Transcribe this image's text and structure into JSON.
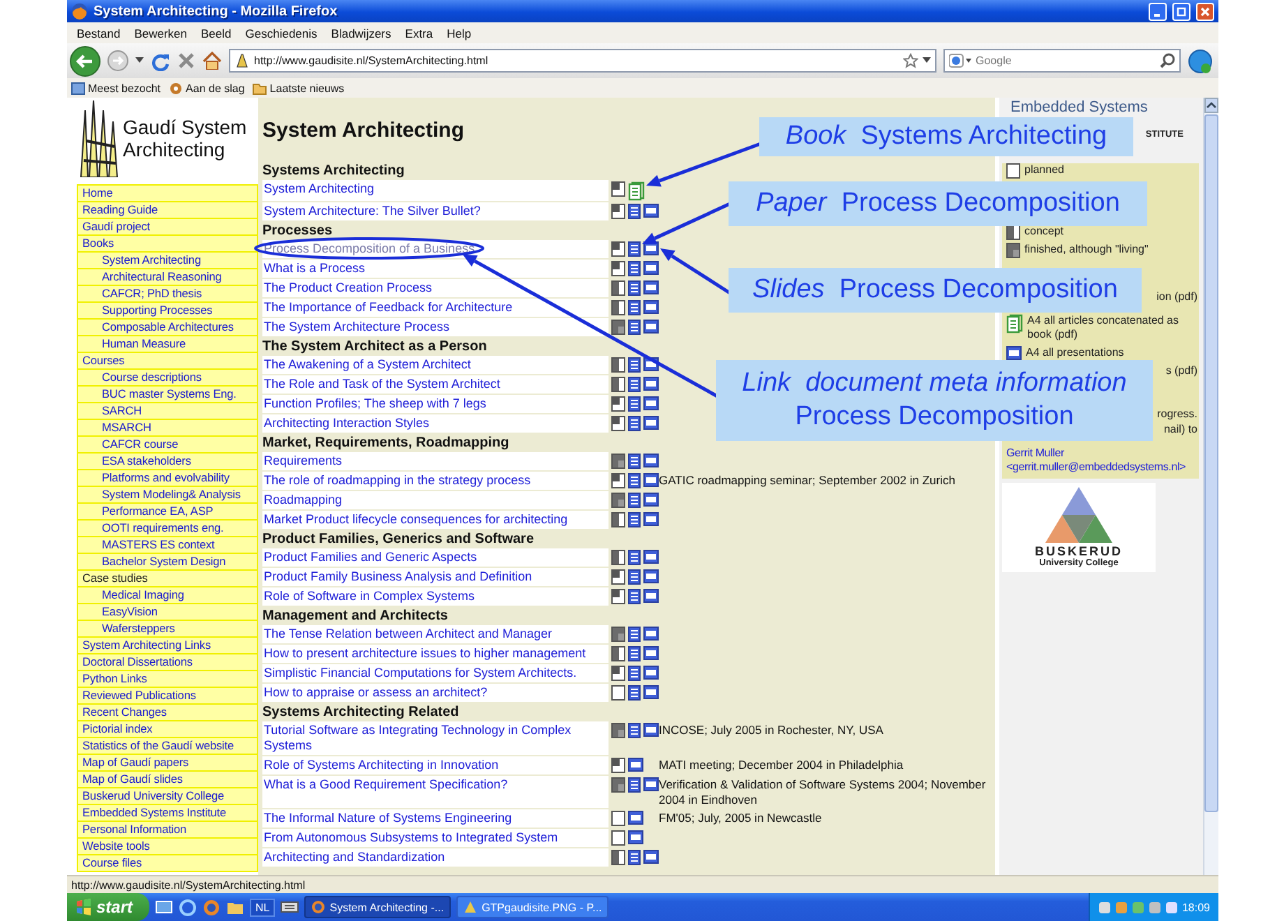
{
  "window": {
    "title": "System Architecting - Mozilla Firefox"
  },
  "menu": [
    "Bestand",
    "Bewerken",
    "Beeld",
    "Geschiedenis",
    "Bladwijzers",
    "Extra",
    "Help"
  ],
  "address_bar": {
    "value": "http://www.gaudisite.nl/SystemArchitecting.html"
  },
  "search": {
    "placeholder": "Google"
  },
  "bookmarks": [
    "Meest bezocht",
    "Aan de slag",
    "Laatste nieuws"
  ],
  "site_logo": "Gaudí System Architecting",
  "nav": [
    {
      "label": "Home",
      "linked": true
    },
    {
      "label": "Reading Guide",
      "linked": true
    },
    {
      "label": "Gaudí project",
      "linked": true
    },
    {
      "label": "Books",
      "linked": true,
      "children": [
        {
          "label": "System Architecting"
        },
        {
          "label": "Architectural Reasoning"
        },
        {
          "label": "CAFCR; PhD thesis"
        },
        {
          "label": "Supporting Processes"
        },
        {
          "label": "Composable Architectures"
        },
        {
          "label": "Human Measure"
        }
      ]
    },
    {
      "label": "Courses",
      "linked": true,
      "children": [
        {
          "label": "Course descriptions"
        },
        {
          "label": "BUC master Systems Eng."
        },
        {
          "label": "SARCH"
        },
        {
          "label": "MSARCH"
        },
        {
          "label": "CAFCR course"
        },
        {
          "label": "ESA stakeholders"
        },
        {
          "label": "Platforms and evolvability"
        },
        {
          "label": "System Modeling& Analysis"
        },
        {
          "label": "Performance EA, ASP"
        },
        {
          "label": "OOTI requirements eng."
        },
        {
          "label": "MASTERS ES context"
        },
        {
          "label": "Bachelor System Design"
        }
      ]
    },
    {
      "label": "Case studies",
      "linked": false,
      "children": [
        {
          "label": "Medical Imaging"
        },
        {
          "label": "EasyVision"
        },
        {
          "label": "Wafersteppers"
        }
      ]
    },
    {
      "label": "System Architecting Links",
      "linked": true
    },
    {
      "label": "Doctoral Dissertations",
      "linked": true
    },
    {
      "label": "Python Links",
      "linked": true
    },
    {
      "label": "Reviewed Publications",
      "linked": true
    },
    {
      "label": "Recent Changes",
      "linked": true
    },
    {
      "label": "Pictorial index",
      "linked": true
    },
    {
      "label": "Statistics of the Gaudí website",
      "linked": true
    },
    {
      "label": "Map of Gaudí papers",
      "linked": true
    },
    {
      "label": "Map of Gaudí slides",
      "linked": true
    },
    {
      "label": "Buskerud University College",
      "linked": true
    },
    {
      "label": "Embedded Systems Institute",
      "linked": true
    },
    {
      "label": "Personal Information",
      "linked": true
    },
    {
      "label": "Website tools",
      "linked": true
    },
    {
      "label": "Course files",
      "linked": true
    }
  ],
  "page_title": "System Architecting",
  "sections": [
    {
      "heading": "Systems Architecting",
      "rows": [
        {
          "title": "System Architecting",
          "visited": false,
          "kind": "draft",
          "book": true,
          "paper": false,
          "slides": false
        },
        {
          "title": "System Architecture: The Silver Bullet?",
          "visited": false,
          "kind": "draft",
          "book": false,
          "paper": true,
          "slides": true
        }
      ]
    },
    {
      "heading": "Processes",
      "rows": [
        {
          "title": "Process Decomposition of a Business",
          "visited": true,
          "kind": "draft",
          "book": false,
          "paper": true,
          "slides": true
        },
        {
          "title": "What is a Process",
          "visited": false,
          "kind": "draft",
          "book": false,
          "paper": true,
          "slides": true
        },
        {
          "title": "The Product Creation Process",
          "visited": false,
          "kind": "concept",
          "book": false,
          "paper": true,
          "slides": true
        },
        {
          "title": "The Importance of Feedback for Architecture",
          "visited": false,
          "kind": "concept",
          "book": false,
          "paper": true,
          "slides": true
        },
        {
          "title": "The System Architecture Process",
          "visited": false,
          "kind": "finished",
          "book": false,
          "paper": true,
          "slides": true
        }
      ]
    },
    {
      "heading": "The System Architect as a Person",
      "rows": [
        {
          "title": "The Awakening of a System Architect",
          "visited": false,
          "kind": "concept",
          "book": false,
          "paper": true,
          "slides": true
        },
        {
          "title": "The Role and Task of the System Architect",
          "visited": false,
          "kind": "concept",
          "book": false,
          "paper": true,
          "slides": true
        },
        {
          "title": "Function Profiles; The sheep with 7 legs",
          "visited": false,
          "kind": "draft",
          "book": false,
          "paper": true,
          "slides": true
        },
        {
          "title": "Architecting Interaction Styles",
          "visited": false,
          "kind": "draft",
          "book": false,
          "paper": true,
          "slides": true
        }
      ]
    },
    {
      "heading": "Market, Requirements, Roadmapping",
      "rows": [
        {
          "title": "Requirements",
          "visited": false,
          "kind": "finished",
          "book": false,
          "paper": true,
          "slides": true
        },
        {
          "title": "The role of roadmapping in the strategy process",
          "visited": false,
          "kind": "draft",
          "book": false,
          "paper": true,
          "slides": true,
          "note": "GATIC roadmapping seminar; September 2002 in Zurich"
        },
        {
          "title": "Roadmapping",
          "visited": false,
          "kind": "finished",
          "book": false,
          "paper": true,
          "slides": true
        },
        {
          "title": "Market Product lifecycle consequences for architecting",
          "visited": false,
          "kind": "concept",
          "book": false,
          "paper": true,
          "slides": true
        }
      ]
    },
    {
      "heading": "Product Families, Generics and Software",
      "rows": [
        {
          "title": "Product Families and Generic Aspects",
          "visited": false,
          "kind": "concept",
          "book": false,
          "paper": true,
          "slides": true
        },
        {
          "title": "Product Family Business Analysis and Definition",
          "visited": false,
          "kind": "draft",
          "book": false,
          "paper": true,
          "slides": true
        },
        {
          "title": "Role of Software in Complex Systems",
          "visited": false,
          "kind": "draft",
          "book": false,
          "paper": true,
          "slides": true
        }
      ]
    },
    {
      "heading": "Management and Architects",
      "rows": [
        {
          "title": "The Tense Relation between Architect and Manager",
          "visited": false,
          "kind": "finished",
          "book": false,
          "paper": true,
          "slides": true
        },
        {
          "title": "How to present architecture issues to higher management",
          "visited": false,
          "kind": "concept",
          "book": false,
          "paper": true,
          "slides": true
        },
        {
          "title": "Simplistic Financial Computations for System Architects.",
          "visited": false,
          "kind": "draft",
          "book": false,
          "paper": true,
          "slides": true
        },
        {
          "title": "How to appraise or assess an architect?",
          "visited": false,
          "kind": "planned",
          "book": false,
          "paper": true,
          "slides": true
        }
      ]
    },
    {
      "heading": "Systems Architecting Related",
      "rows": [
        {
          "title": "Tutorial Software as Integrating Technology in Complex Systems",
          "visited": false,
          "kind": "finished",
          "book": false,
          "paper": true,
          "slides": true,
          "note": "INCOSE; July 2005 in Rochester, NY, USA"
        },
        {
          "title": "Role of Systems Architecting in Innovation",
          "visited": false,
          "kind": "draft",
          "book": false,
          "paper": false,
          "slides": true,
          "note": "MATI meeting; December 2004 in Philadelphia"
        },
        {
          "title": "What is a Good Requirement Specification?",
          "visited": false,
          "kind": "finished",
          "book": false,
          "paper": true,
          "slides": true,
          "note": "Verification & Validation of Software Systems 2004; November 2004 in Eindhoven"
        },
        {
          "title": "The Informal Nature of Systems Engineering",
          "visited": false,
          "kind": "planned",
          "book": false,
          "paper": false,
          "slides": true,
          "note": "FM'05; July, 2005 in Newcastle"
        },
        {
          "title": "From Autonomous Subsystems to Integrated System",
          "visited": false,
          "kind": "planned",
          "book": false,
          "paper": false,
          "slides": true
        },
        {
          "title": "Architecting and Standardization",
          "visited": false,
          "kind": "concept",
          "book": false,
          "paper": true,
          "slides": true
        }
      ]
    }
  ],
  "side_panel": {
    "logo": "Embedded Systems",
    "logo_fragment": "STITUTE",
    "lines": [
      {
        "kind": "planned",
        "text": "planned"
      },
      {
        "kind": "concept",
        "text": "concept"
      },
      {
        "kind": "finished",
        "text": "finished, although \"living\""
      },
      {
        "kind": "fragment",
        "text": "ion (pdf)"
      },
      {
        "kind": "book",
        "text": "A4 all articles concatenated as book (pdf)"
      },
      {
        "kind": "slides",
        "text": "A4 all presentations"
      },
      {
        "kind": "fragment",
        "text": "s (pdf)"
      },
      {
        "kind": "fragment",
        "text": "rogress."
      },
      {
        "kind": "fragment",
        "text": "nail) to"
      },
      {
        "kind": "link",
        "text": "Gerrit Muller"
      },
      {
        "kind": "link",
        "text": "<gerrit.muller@embeddedsystems.nl>"
      }
    ],
    "college": {
      "name": "BUSKERUD",
      "subtitle": "University College"
    }
  },
  "callouts": [
    "*Book*  Systems Architecting",
    "*Paper*  Process Decomposition",
    "*Slides*  Process Decomposition",
    "*Link  document meta information*\nProcess Decomposition"
  ],
  "status_bar": "http://www.gaudisite.nl/SystemArchitecting.html",
  "taskbar": {
    "start": "start",
    "language": "NL",
    "tasks": [
      {
        "label": "System Architecting -...",
        "selected": true
      },
      {
        "label": "GTPgaudisite.PNG - P...",
        "selected": false
      }
    ],
    "clock": "18:09"
  }
}
